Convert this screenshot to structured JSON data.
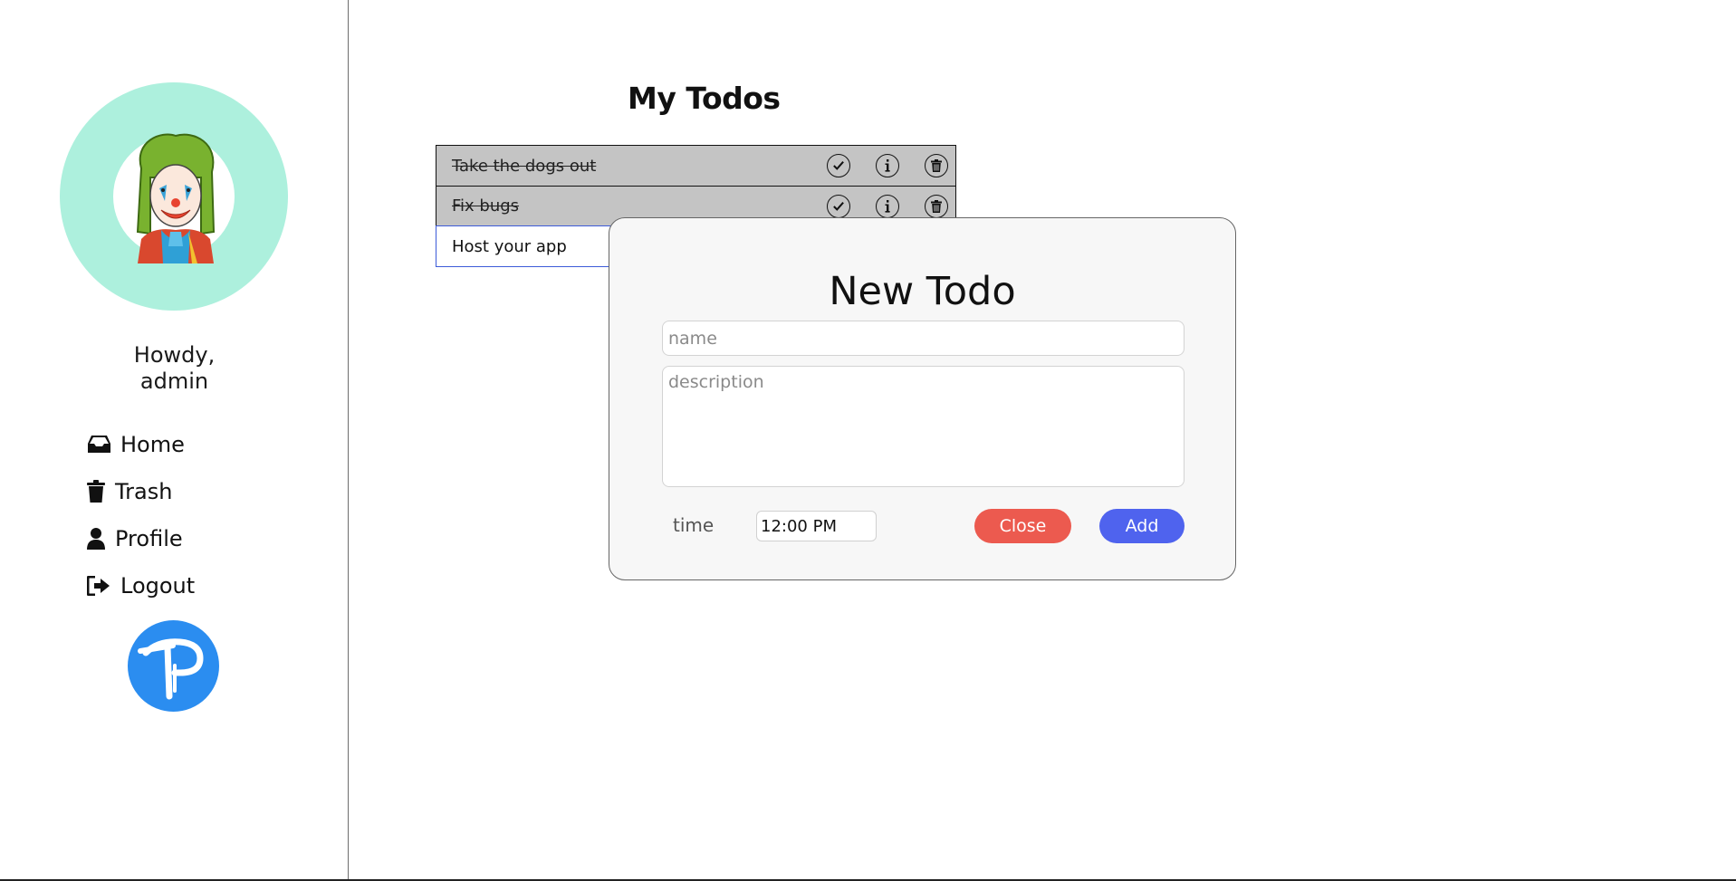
{
  "sidebar": {
    "avatar_icon": "joker-avatar",
    "greeting_line1": "Howdy,",
    "greeting_line2": "admin",
    "nav": [
      {
        "label": "Home",
        "icon": "inbox-icon"
      },
      {
        "label": "Trash",
        "icon": "trash-icon"
      },
      {
        "label": "Profile",
        "icon": "user-icon"
      },
      {
        "label": "Logout",
        "icon": "sign-out-icon"
      }
    ],
    "logo_icon": "tp-logo"
  },
  "main": {
    "title": "My Todos",
    "todos": [
      {
        "name": "Take the dogs out",
        "done": true
      },
      {
        "name": "Fix bugs",
        "done": true
      },
      {
        "name": "Host your app",
        "done": false
      }
    ]
  },
  "modal": {
    "title": "New Todo",
    "name_placeholder": "name",
    "description_placeholder": "description",
    "time_label": "time",
    "time_value": "12:00 PM",
    "close_label": "Close",
    "add_label": "Add"
  },
  "colors": {
    "avatar_bg": "#adf0dd",
    "todo_done_bg": "#c4c4c4",
    "close_button": "#ec5a4f",
    "add_button": "#4f63ee",
    "logo_bg": "#2b8df0"
  }
}
